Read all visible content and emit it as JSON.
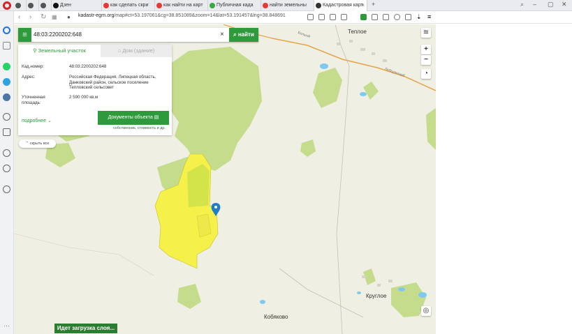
{
  "tabs": [
    {
      "label": "",
      "color": "#555"
    },
    {
      "label": "",
      "color": "#555"
    },
    {
      "label": "",
      "color": "#555"
    },
    {
      "label": "Дзен",
      "color": "#111"
    },
    {
      "label": "как сделать скри",
      "color": "#e53935"
    },
    {
      "label": "как найти на карт",
      "color": "#e53935"
    },
    {
      "label": "Публичная када",
      "color": "#3aa845"
    },
    {
      "label": "найти земельны",
      "color": "#e53935"
    },
    {
      "label": "Кадастровая карт",
      "color": "#333"
    }
  ],
  "address": {
    "domain": "kadastr-egrn.org",
    "path": "/map#ct=53.197061&cg=38.851089&zoom=14&lat=53.191457&lng=38.848691"
  },
  "search": {
    "value": "48:03:2200202:648",
    "button_label": "найти",
    "clear_label": "×"
  },
  "card": {
    "tab_active": "Земельный участок",
    "tab_inactive": "Дом (здание)",
    "rows": [
      {
        "label": "Кад.номер:",
        "value": "48:03:2200202:648"
      },
      {
        "label": "Адрес:",
        "value": "Российская Федерация, Липецкая область, Данковский район, сельское поселение Тепловский сельсовет"
      },
      {
        "label": "Уточненная площадь:",
        "value": "2 590 000 кв.м"
      }
    ],
    "more_label": "подробнее",
    "docs_button": "Документы объекта",
    "docs_sub": "собственник, стоимость и др."
  },
  "hide_all": "скрыть все",
  "loading": "Идет загрузка слоя...",
  "places": {
    "teploe": "Теплое",
    "krugloe": "Круглое",
    "kobyakovo": "Кобяково",
    "road1": "Болшой",
    "road2": "Лебедянский"
  },
  "colors": {
    "accent": "#2f9a3c",
    "parcel": "#f6f04a",
    "forest": "#c5dc8c",
    "water": "#7fc9ee"
  }
}
